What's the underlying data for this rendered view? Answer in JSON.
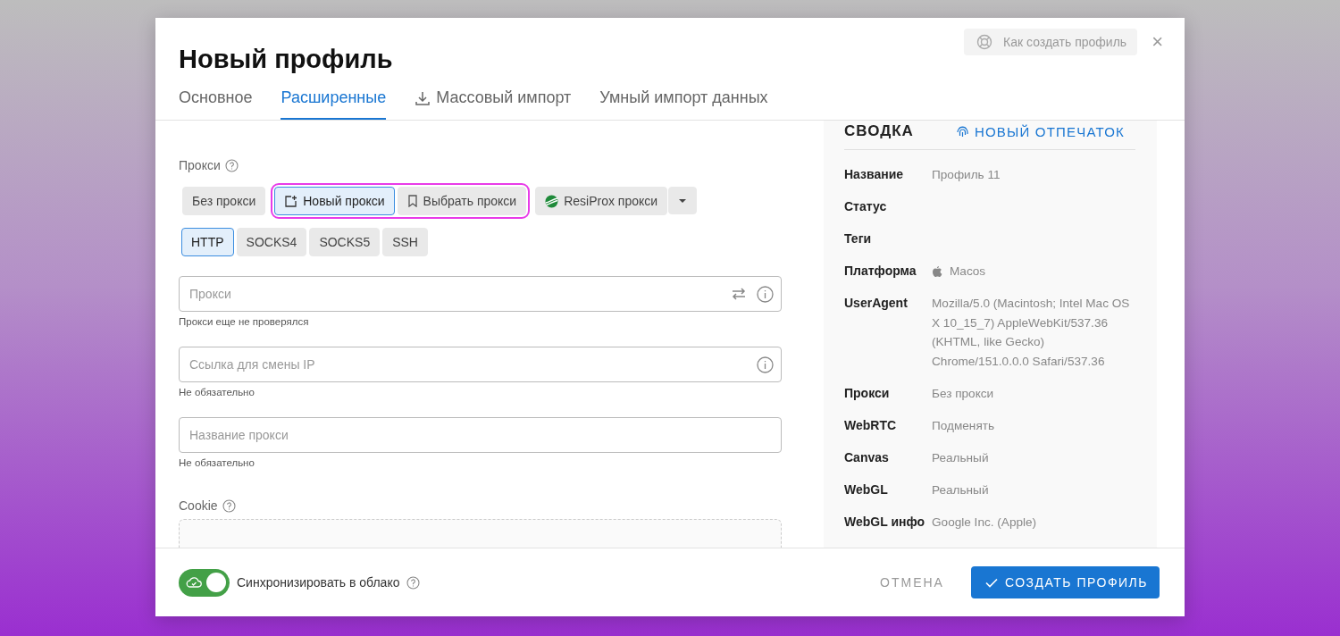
{
  "dialog": {
    "title": "Новый профиль",
    "help_button": "Как создать профиль",
    "close": "×"
  },
  "tabs": [
    {
      "label": "Основное",
      "selected": false,
      "kind": "plain"
    },
    {
      "label": "Расширенные",
      "selected": true,
      "kind": "plain"
    },
    {
      "label": "Массовый импорт",
      "selected": false,
      "kind": "download"
    },
    {
      "label": "Умный импорт данных",
      "selected": false,
      "kind": "plain"
    }
  ],
  "proxy": {
    "label": "Прокси",
    "modes": [
      {
        "label": "Без прокси",
        "selected": false,
        "highlighted": false,
        "kind": "plain"
      },
      {
        "label": "Новый прокси",
        "selected": true,
        "highlighted": true,
        "kind": "new"
      },
      {
        "label": "Выбрать прокси",
        "selected": false,
        "highlighted": true,
        "kind": "bookmark"
      },
      {
        "label": "ResiProx прокси",
        "selected": false,
        "highlighted": false,
        "kind": "brand"
      }
    ],
    "protocols": [
      {
        "label": "HTTP",
        "selected": true
      },
      {
        "label": "SOCKS4",
        "selected": false
      },
      {
        "label": "SOCKS5",
        "selected": false
      },
      {
        "label": "SSH",
        "selected": false
      }
    ],
    "fields": [
      {
        "placeholder": "Прокси",
        "helper": "Прокси еще не проверялся",
        "swap": true,
        "info": true
      },
      {
        "placeholder": "Ссылка для смены IP",
        "helper": "Не обязательно",
        "swap": false,
        "info": true
      },
      {
        "placeholder": "Название прокси",
        "helper": "Не обязательно",
        "swap": false,
        "info": false
      }
    ]
  },
  "cookie": {
    "label": "Cookie"
  },
  "summary": {
    "title": "СВОДКА",
    "fingerprint_button": "НОВЫЙ ОТПЕЧАТОК",
    "rows": [
      {
        "label": "Название",
        "value": "Профиль 11",
        "kind": "text"
      },
      {
        "label": "Статус",
        "kind": "text"
      },
      {
        "label": "Теги",
        "kind": "text"
      },
      {
        "label": "Платформа",
        "value": "Macos",
        "kind": "os"
      },
      {
        "label": "UserAgent",
        "value": "Mozilla/5.0 (Macintosh; Intel Mac OS X 10_15_7) AppleWebKit/537.36 (KHTML, like Gecko) Chrome/151.0.0.0 Safari/537.36",
        "kind": "text"
      },
      {
        "label": "Прокси",
        "value": "Без прокси",
        "kind": "text"
      },
      {
        "label": "WebRTC",
        "value": "Подменять",
        "kind": "text"
      },
      {
        "label": "Canvas",
        "value": "Реальный",
        "kind": "text"
      },
      {
        "label": "WebGL",
        "value": "Реальный",
        "kind": "text"
      },
      {
        "label": "WebGL инфо",
        "value": "Google Inc. (Apple)",
        "kind": "text"
      }
    ]
  },
  "footer": {
    "sync_label": "Синхронизировать в облако",
    "sync_on": true,
    "cancel": "ОТМЕНА",
    "create": "СОЗДАТЬ ПРОФИЛЬ"
  }
}
